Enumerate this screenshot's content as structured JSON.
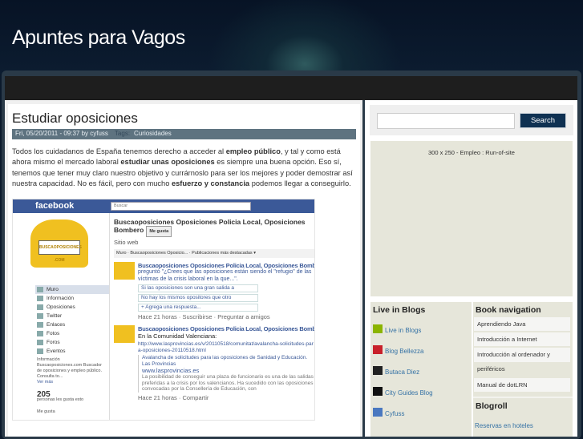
{
  "site": {
    "title": "Apuntes para Vagos"
  },
  "post": {
    "title": "Estudiar oposiciones",
    "meta": "Fri, 05/20/2011 - 09:37 by cyfuss",
    "tags_label": "Tags:",
    "tag": "Curiosidades",
    "body": [
      {
        "t": "Todos los cuidadanos de España tenemos derecho a acceder al "
      },
      {
        "b": "empleo público"
      },
      {
        "t": ", y tal y como está ahora mismo el mercado laboral "
      },
      {
        "b": "estudiar unas oposiciones"
      },
      {
        "t": " es siempre una buena opción. Eso sí, tenemos que tener muy claro nuestro objetivo y currárnoslo para ser los mejores y poder demostrar así nuestra capacidad. No es fácil, pero con mucho "
      },
      {
        "b": "esfuerzo y constancia"
      },
      {
        "t": " podemos llegar a conseguirlo."
      }
    ],
    "image": {
      "logo": "facebook",
      "search": "Buscar",
      "pic_text": "BUSCAOPOSICIONES .COM",
      "menu": [
        "Muro",
        "Información",
        "Oposiciones",
        "Twitter",
        "Enlaces",
        "Fotos",
        "Foros",
        "Eventos"
      ],
      "info_title": "Información",
      "info_text": "Buscaoposiciones.com Buscador de oposiciones y empleo público. Consulta to...",
      "see_more": "Ver más",
      "likes": "205",
      "likes_label": "personas les gusta esto",
      "like_label": "Me gusta",
      "page_name": "Buscaoposiciones Oposiciones Policia Local, Oposiciones Bombero",
      "like_btn": "Me gusta",
      "category": "Sitio web",
      "tabs": "Muro   ·   Buscaoposiciones Oposicio... · Publicaciones más destacadas ▾",
      "post1_author": "Buscaoposiciones Oposiciones Policia Local, Oposiciones Bombero",
      "post1_text": "preguntó \"¿Crees que las oposiciones están siendo el \"refugio\" de las víctimas de la crisis laboral en la que...\".",
      "opt1": "Si las oposiciones son una gran salida a",
      "opt2": "No hay los mismos opositores que otro",
      "opt3": "+ Agrega una respuesta...",
      "post1_footer": "Hace 21 horas · Suscribirse · Preguntar a amigos",
      "post2_author": "Buscaoposiciones Oposiciones Policia Local, Oposiciones Bombero",
      "post2_text": "En la Comunidad Valenciana:",
      "post2_link": "http://www.lasprovincias.es/v/20110518/comunitat/avalancha-solicitudes-para-oposiciones-20110518.html",
      "post2_title": "Avalancha de solicitudes para las oposiciones de Sanidad y Educación. Las Provincias",
      "post2_domain": "www.lasprovincias.es",
      "post2_desc": "La posibilidad de conseguir una plaza de funcionario es una de las salidas preferidas a la crisis por los valencianos. Ha sucedido con las oposiciones convocadas por la Consellería de Educación, con",
      "post2_footer": "Hace 21 horas · Compartir"
    }
  },
  "sidebar": {
    "search_button": "Search",
    "ad": "300 x 250 - Empleo : Run-of-site",
    "live_in_blogs": {
      "title": "Live in Blogs",
      "items": [
        {
          "label": "Live in Blogs",
          "color": "#8bb400"
        },
        {
          "label": "Blog Bellezza",
          "color": "#c8202a"
        },
        {
          "label": "Butaca Diez",
          "color": "#222222"
        },
        {
          "label": "City Guides Blog",
          "color": "#111111"
        },
        {
          "label": "Cyfuss",
          "color": "#4a78c0"
        }
      ]
    },
    "book_nav": {
      "title": "Book navigation",
      "items": [
        "Aprendiendo Java",
        "Introducción a Internet",
        "Introducción al ordenador y periféricos",
        "Manual de dotLRN"
      ]
    },
    "blogroll": {
      "title": "Blogroll",
      "items": [
        "Reservas en hoteles"
      ]
    }
  }
}
